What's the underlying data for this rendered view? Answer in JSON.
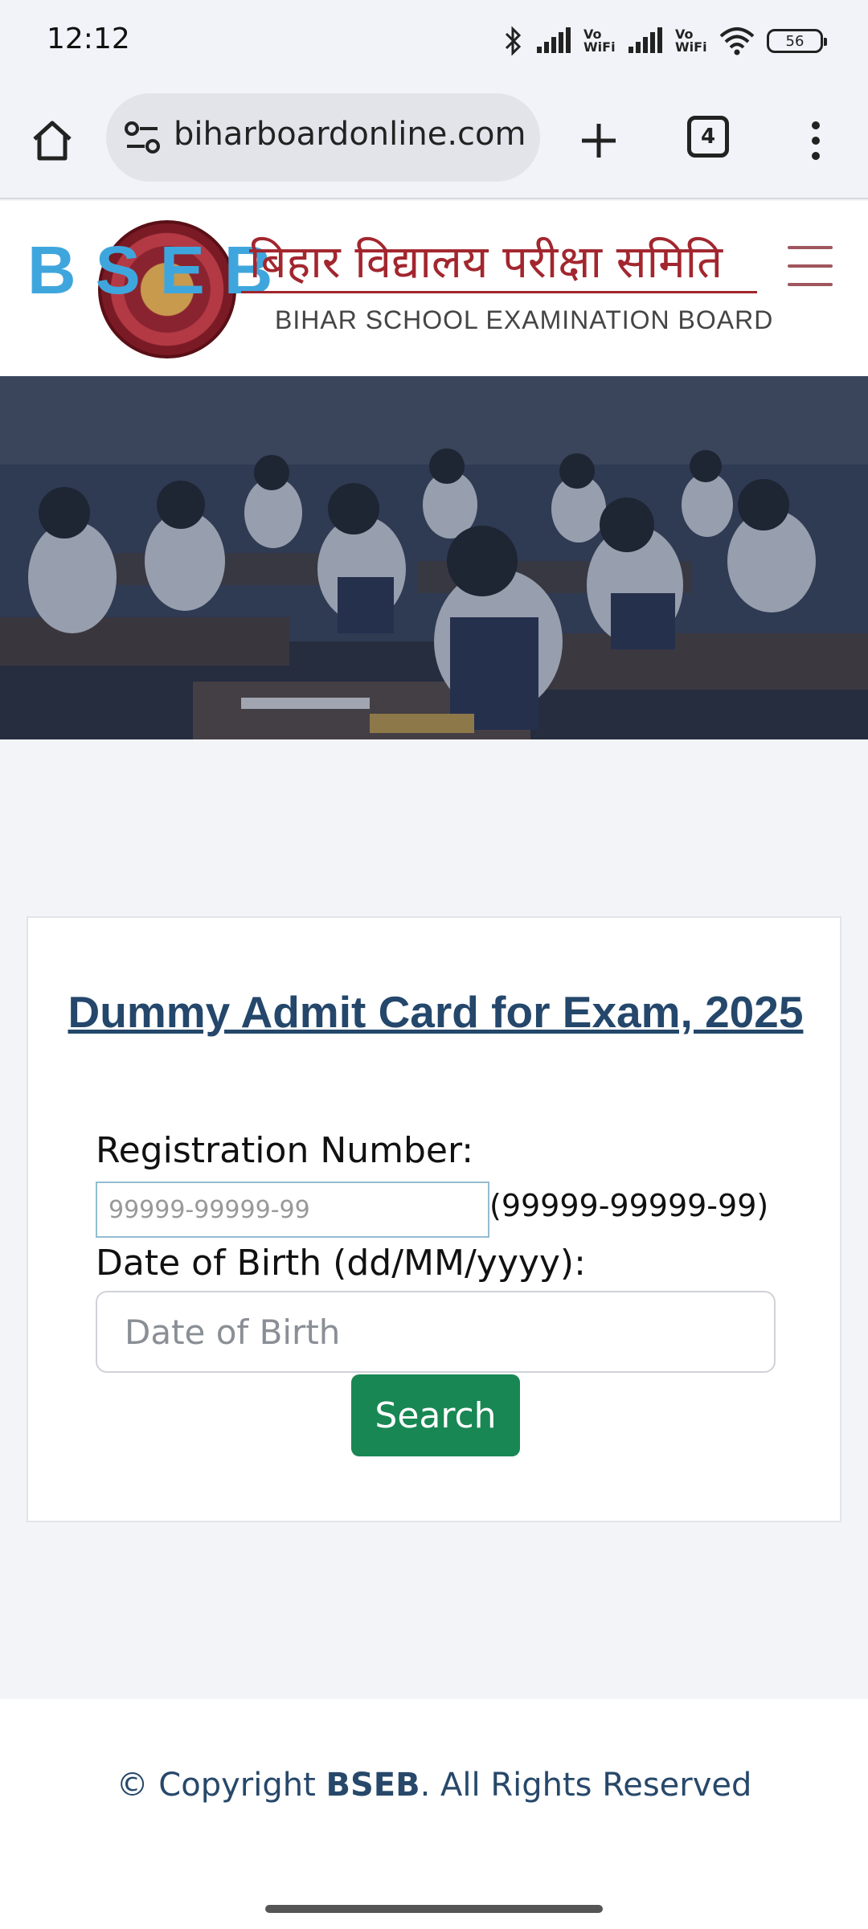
{
  "status_bar": {
    "time": "12:12",
    "battery": "56",
    "icons": [
      "bluetooth-icon",
      "signal-icon",
      "vowifi-icon",
      "signal-icon",
      "vowifi-icon",
      "wifi-icon",
      "battery-icon"
    ],
    "vowifi_1": "Vo WiFi",
    "vowifi_2": "Vo WiFi"
  },
  "browser": {
    "url": "biharboardonline.com",
    "tab_count": "4",
    "icons": [
      "home-icon",
      "site-settings-icon",
      "new-tab-icon",
      "tab-switcher-icon",
      "more-options-icon"
    ]
  },
  "site_header": {
    "logo_letters": "BSEB",
    "hindi_name": "बिहार विद्यालय परीक्षा समिति",
    "english_name": "BIHAR SCHOOL EXAMINATION BOARD",
    "menu_icon": "hamburger-menu-icon",
    "colors": {
      "bseb_blue": "#3fa6dd",
      "hindi_red": "#a2262e"
    }
  },
  "hero": {
    "image": "students-writing-exam-photo"
  },
  "form": {
    "title": "Dummy Admit Card for Exam, 2025",
    "registration_label": "Registration Number:",
    "registration_placeholder": "99999-99999-99",
    "registration_value": "",
    "registration_hint": "(99999-99999-99)",
    "dob_label": "Date of Birth (dd/MM/yyyy):",
    "dob_placeholder": "Date of Birth",
    "dob_value": "",
    "search_label": "Search",
    "colors": {
      "title": "#24476b",
      "button": "#198754"
    }
  },
  "footer": {
    "copyright_prefix": "© Copyright ",
    "copyright_brand": "BSEB",
    "copyright_suffix": ". All Rights Reserved"
  }
}
